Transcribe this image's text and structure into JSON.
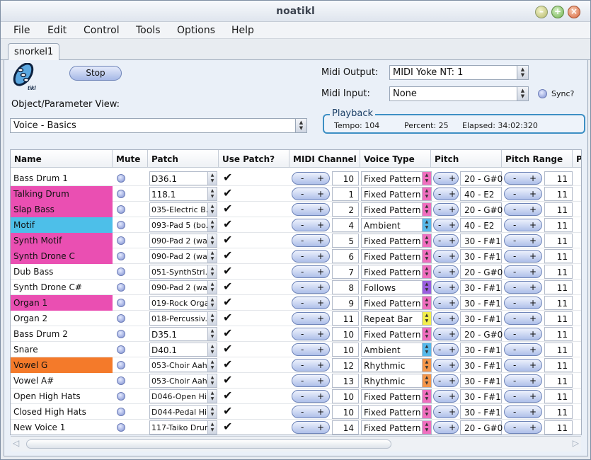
{
  "window": {
    "title": "noatikl"
  },
  "menu": [
    "File",
    "Edit",
    "Control",
    "Tools",
    "Options",
    "Help"
  ],
  "tab": "snorkel1",
  "logo_text": "tikl",
  "stop_label": "Stop",
  "object_view": {
    "label": "Object/Parameter View:",
    "value": "Voice - Basics"
  },
  "midi_output": {
    "label": "Midi Output:",
    "value": "MIDI Yoke NT:  1"
  },
  "midi_input": {
    "label": "Midi Input:",
    "value": "None"
  },
  "sync_label": "Sync?",
  "playback": {
    "legend": "Playback",
    "tempo": "Tempo: 104",
    "percent": "Percent: 25",
    "elapsed": "Elapsed: 34:02:320"
  },
  "columns": [
    "Name",
    "Mute",
    "Patch",
    "Use Patch?",
    "MIDI Channel",
    "Voice Type",
    "Pitch",
    "Pitch Range",
    "P"
  ],
  "stepper": {
    "minus": "-",
    "plus": "+"
  },
  "rows": [
    {
      "name": " Bass Drum 1",
      "color": "",
      "patch": "D36.1",
      "patch_big": true,
      "channel": "10",
      "voice_type": "Fixed Pattern",
      "vt_color": "#f06fbf",
      "pitch": "20 - G#0",
      "range": "11"
    },
    {
      "name": "Talking Drum",
      "color": "#ea4fb2",
      "patch": "118.1",
      "patch_big": true,
      "channel": "1",
      "voice_type": "Fixed Pattern",
      "vt_color": "#f06fbf",
      "pitch": " 40 - E2",
      "range": "11"
    },
    {
      "name": "Slap Bass",
      "color": "#ea4fb2",
      "patch": "035-Electric B...",
      "patch_big": false,
      "channel": "2",
      "voice_type": "Fixed Pattern",
      "vt_color": "#f06fbf",
      "pitch": "20 - G#0",
      "range": "11"
    },
    {
      "name": "Motif",
      "color": "#4dbfe9",
      "patch": "093-Pad 5 (bo...",
      "patch_big": false,
      "channel": "4",
      "voice_type": "Ambient",
      "vt_color": "#57b9ea",
      "pitch": " 40 - E2",
      "range": "11"
    },
    {
      "name": "Synth Motif",
      "color": "#ea4fb2",
      "patch": "090-Pad 2 (wa...",
      "patch_big": false,
      "channel": "5",
      "voice_type": "Fixed Pattern",
      "vt_color": "#f06fbf",
      "pitch": "30 - F#1",
      "range": "11"
    },
    {
      "name": "Synth Drone C",
      "color": "#ea4fb2",
      "patch": "090-Pad 2 (wa...",
      "patch_big": false,
      "channel": "6",
      "voice_type": "Fixed Pattern",
      "vt_color": "#f06fbf",
      "pitch": "30 - F#1",
      "range": "11"
    },
    {
      "name": "Dub Bass",
      "color": "",
      "patch": "051-SynthStri...",
      "patch_big": false,
      "channel": "7",
      "voice_type": "Fixed Pattern",
      "vt_color": "#f06fbf",
      "pitch": "20 - G#0",
      "range": "11"
    },
    {
      "name": "Synth Drone C#",
      "color": "",
      "patch": "090-Pad 2 (wa...",
      "patch_big": false,
      "channel": "8",
      "voice_type": "Follows",
      "vt_color": "#9b5ee0",
      "pitch": "30 - F#1",
      "range": "11"
    },
    {
      "name": "Organ 1",
      "color": "#ea4fb2",
      "patch": "019-Rock Organ",
      "patch_big": false,
      "channel": "9",
      "voice_type": "Fixed Pattern",
      "vt_color": "#f06fbf",
      "pitch": "30 - F#1",
      "range": "11"
    },
    {
      "name": "Organ 2",
      "color": "",
      "patch": "018-Percussiv...",
      "patch_big": false,
      "channel": "11",
      "voice_type": "Repeat Bar",
      "vt_color": "#f2ee4c",
      "pitch": "30 - F#1",
      "range": "11"
    },
    {
      "name": "Bass Drum 2",
      "color": "",
      "patch": "D35.1",
      "patch_big": true,
      "channel": "10",
      "voice_type": "Fixed Pattern",
      "vt_color": "#f06fbf",
      "pitch": "20 - G#0",
      "range": "11"
    },
    {
      "name": "Snare",
      "color": "",
      "patch": "D40.1",
      "patch_big": true,
      "channel": "10",
      "voice_type": "Ambient",
      "vt_color": "#57b9ea",
      "pitch": "30 - F#1",
      "range": "11"
    },
    {
      "name": "Vowel G",
      "color": "#f47a2a",
      "patch": "053-Choir Aahs",
      "patch_big": false,
      "channel": "12",
      "voice_type": "Rhythmic",
      "vt_color": "#f4964a",
      "pitch": "30 - F#1",
      "range": "11"
    },
    {
      "name": "Vowel  A#",
      "color": "",
      "patch": "053-Choir Aahs",
      "patch_big": false,
      "channel": "13",
      "voice_type": "Rhythmic",
      "vt_color": "#f4964a",
      "pitch": "30 - F#1",
      "range": "11"
    },
    {
      "name": "Open High Hats",
      "color": "",
      "patch": "D046-Open Hi...",
      "patch_big": false,
      "channel": "10",
      "voice_type": "Fixed Pattern",
      "vt_color": "#f06fbf",
      "pitch": "30 - F#1",
      "range": "11"
    },
    {
      "name": "Closed High Hats",
      "color": "",
      "patch": "D044-Pedal Hi...",
      "patch_big": false,
      "channel": "10",
      "voice_type": "Fixed Pattern",
      "vt_color": "#f06fbf",
      "pitch": "30 - F#1",
      "range": "11"
    },
    {
      "name": "New Voice 1",
      "color": "",
      "patch": "117-Taiko Drum",
      "patch_big": false,
      "channel": "14",
      "voice_type": "Fixed Pattern",
      "vt_color": "#f06fbf",
      "pitch": "20 - G#0",
      "range": "11"
    }
  ]
}
